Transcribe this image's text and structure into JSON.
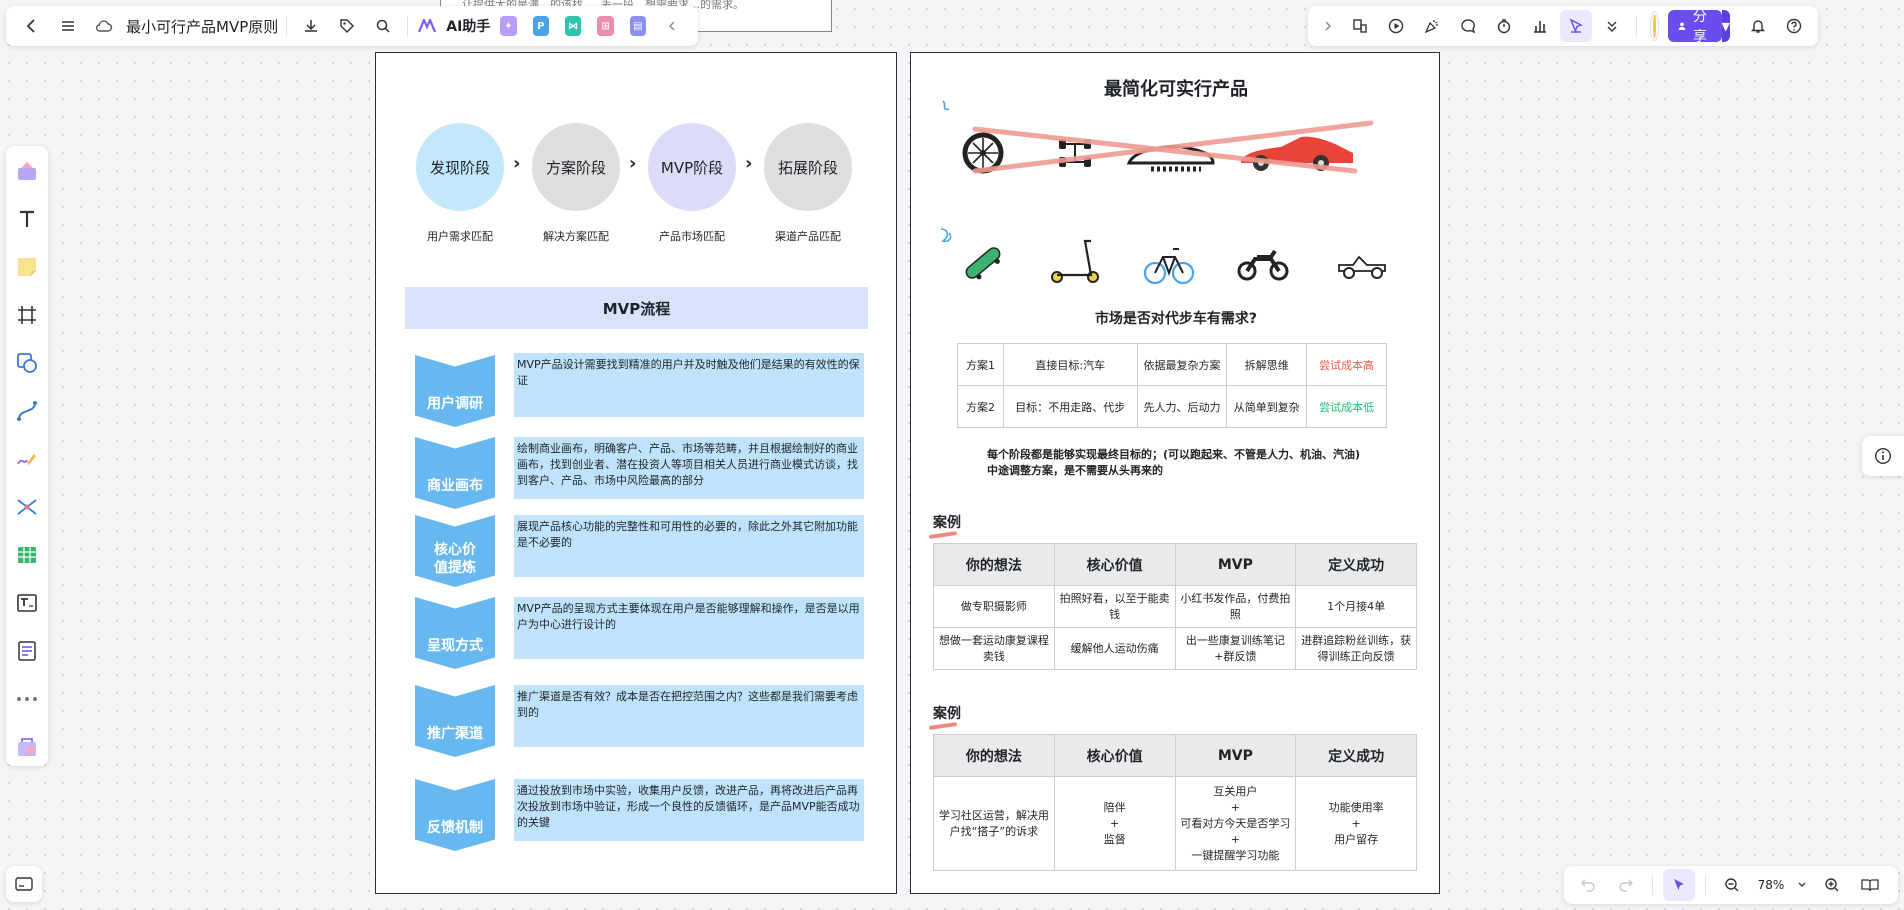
{
  "top_bar": {
    "title": "最小可行产品MVP原则",
    "ai_label": "AI助手"
  },
  "peek_text": "…让提供大的是满…的该找…, 丢一段…想需要求…的需求。",
  "share": {
    "label": "分享"
  },
  "zoom": {
    "value": "78%"
  },
  "left_board": {
    "stages": [
      {
        "label": "发现阶段",
        "sub": "用户需求匹配",
        "color": "#c3e7fb"
      },
      {
        "label": "方案阶段",
        "sub": "解决方案匹配",
        "color": "#dedede"
      },
      {
        "label": "MVP阶段",
        "sub": "产品市场匹配",
        "color": "#dcdcf8"
      },
      {
        "label": "拓展阶段",
        "sub": "渠道产品匹配",
        "color": "#dedede"
      }
    ],
    "flow_title": "MVP流程",
    "steps": [
      {
        "name": "用户调研",
        "desc": "MVP产品设计需要找到精准的用户并及时触及他们是结果的有效性的保证"
      },
      {
        "name": "商业画布",
        "desc": "绘制商业画布，明确客户、产品、市场等范畴，并且根据绘制好的商业画布，找到创业者、潜在投资人等项目相关人员进行商业模式访谈，找到客户、产品、市场中风险最高的部分"
      },
      {
        "name": "核心价值提炼",
        "desc": "展现产品核心功能的完整性和可用性的必要的，除此之外其它附加功能是不必要的"
      },
      {
        "name": "呈现方式",
        "desc": "MVP产品的呈现方式主要体现在用户是否能够理解和操作，是否是以用户为中心进行设计的"
      },
      {
        "name": "推广渠道",
        "desc": "推广渠道是否有效？成本是否在把控范围之内？这些都是我们需要考虑到的"
      },
      {
        "name": "反馈机制",
        "desc": "通过投放到市场中实验，收集用户反馈，改进产品，再将改进后产品再次投放到市场中验证，形成一个良性的反馈循环，是产品MVP能否成功的关键"
      }
    ]
  },
  "right_board": {
    "title": "最简化可实行产品",
    "question": "市场是否对代步车有需求?",
    "compare_rows": [
      {
        "c1": "方案1",
        "c2": "直接目标:汽车",
        "c3": "依据最复杂方案",
        "c4": "拆解思维",
        "c5": "尝试成本高",
        "c5_color": "#f05a4a"
      },
      {
        "c1": "方案2",
        "c2": "目标：不用走路、代步",
        "c3": "先人力、后动力",
        "c4": "从简单到复杂",
        "c5": "尝试成本低",
        "c5_color": "#1fbf73"
      }
    ],
    "note_line1": "每个阶段都是能够实现最终目标的；(可以跑起来、不管是人力、机油、汽油)",
    "note_line2": "中途调整方案，是不需要从头再来的",
    "case_label": "案例",
    "case_headers": [
      "你的想法",
      "核心价值",
      "MVP",
      "定义成功"
    ],
    "case1_rows": [
      [
        "做专职摄影师",
        "拍照好看，以至于能卖钱",
        "小红书发作品，付费拍照",
        "1个月接4单"
      ],
      [
        "想做一套运动康复课程卖钱",
        "缓解他人运动伤痛",
        "出一些康复训练笔记+群反馈",
        "进群追踪粉丝训练，获得训练正向反馈"
      ]
    ],
    "case2_rows": [
      [
        "学习社区运营，解决用户找“搭子”的诉求",
        "陪伴\n+\n监督",
        "互关用户\n+\n可看对方今天是否学习\n+\n一键提醒学习功能",
        "功能使用率\n+\n用户留存"
      ]
    ],
    "vehicles_row1": [
      "wheel-icon",
      "wheels-axle-icon",
      "car-body-icon",
      "sports-car-icon"
    ],
    "vehicles_row2": [
      "skateboard-icon",
      "scooter-icon",
      "bicycle-icon",
      "motorcycle-icon",
      "convertible-car-icon"
    ]
  },
  "colors": {
    "accent": "#6a4cf0",
    "step_blue": "#67b8f0",
    "step_desc_bg": "#bfe3fa"
  }
}
